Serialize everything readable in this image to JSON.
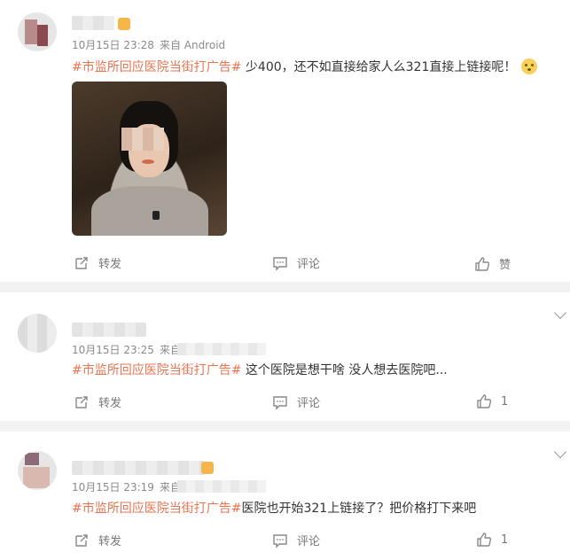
{
  "posts": [
    {
      "date": "10月15日 23:28",
      "source": "来自 Android",
      "hashtag": "#市监所回应医院当街打广告#",
      "text": " 少400，还不如直接给家人么321直接上链接呢！",
      "emoji": "smile-emoji",
      "actions": {
        "repost": "转发",
        "comment": "评论",
        "like": "赞"
      }
    },
    {
      "date": "10月15日 23:25",
      "source": "来自",
      "hashtag": "#市监所回应医院当街打广告#",
      "text": " 这个医院是想干啥 没人想去医院吧...",
      "actions": {
        "repost": "转发",
        "comment": "评论",
        "like": "1"
      }
    },
    {
      "date": "10月15日 23:19",
      "source": "来自",
      "hashtag": "#市监所回应医院当街打广告#",
      "text": "医院也开始321上链接了？把价格打下来吧",
      "actions": {
        "repost": "转发",
        "comment": "评论",
        "like": "1"
      }
    }
  ],
  "colors": {
    "hashtag": "#eb7350",
    "meta": "#8a8a8a",
    "action": "#777777"
  },
  "icons": [
    "repost-icon",
    "comment-icon",
    "like-icon",
    "chevron-down-icon"
  ]
}
